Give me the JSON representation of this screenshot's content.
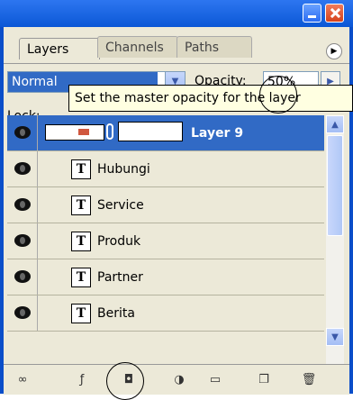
{
  "tabs": [
    {
      "label": "Layers"
    },
    {
      "label": "Channels"
    },
    {
      "label": "Paths"
    }
  ],
  "panel_menu_icon": "circle-arrow-right-icon",
  "blend_mode": {
    "value": "Normal"
  },
  "opacity": {
    "label": "Opacity:",
    "value": "50%"
  },
  "lock": {
    "label": "Lock:"
  },
  "tooltip": "Set the master opacity for the layer",
  "layers": [
    {
      "name": "Layer 9",
      "type": "image",
      "selected": true
    },
    {
      "name": "Hubungi",
      "type": "text"
    },
    {
      "name": "Service",
      "type": "text"
    },
    {
      "name": "Produk",
      "type": "text"
    },
    {
      "name": "Partner",
      "type": "text"
    },
    {
      "name": "Berita",
      "type": "text"
    }
  ],
  "text_layer_icon": "T",
  "toolbar_icons": [
    "link-icon",
    "layer-style-icon",
    "mask-icon",
    "adjustment-icon",
    "folder-icon",
    "new-layer-icon",
    "trash-icon"
  ],
  "colors": {
    "selection": "#316ac5",
    "panel": "#ece9d8",
    "titlebar": "#0b57d6"
  }
}
